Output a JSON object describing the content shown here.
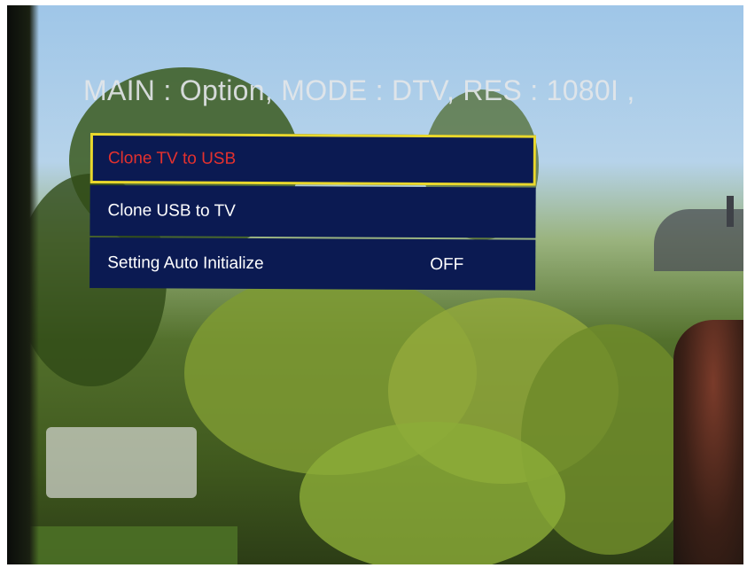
{
  "osd": {
    "header": "MAIN : Option, MODE : DTV, RES : 1080I ,"
  },
  "menu": {
    "items": [
      {
        "label": "Clone TV to USB",
        "value": "",
        "selected": true
      },
      {
        "label": "Clone USB to TV",
        "value": "",
        "selected": false
      },
      {
        "label": "Setting Auto Initialize",
        "value": "OFF",
        "selected": false
      }
    ]
  },
  "colors": {
    "menu_bg": "#0b1a52",
    "selected_border": "#e9d82c",
    "selected_text": "#e4312e",
    "text": "#ffffff"
  }
}
